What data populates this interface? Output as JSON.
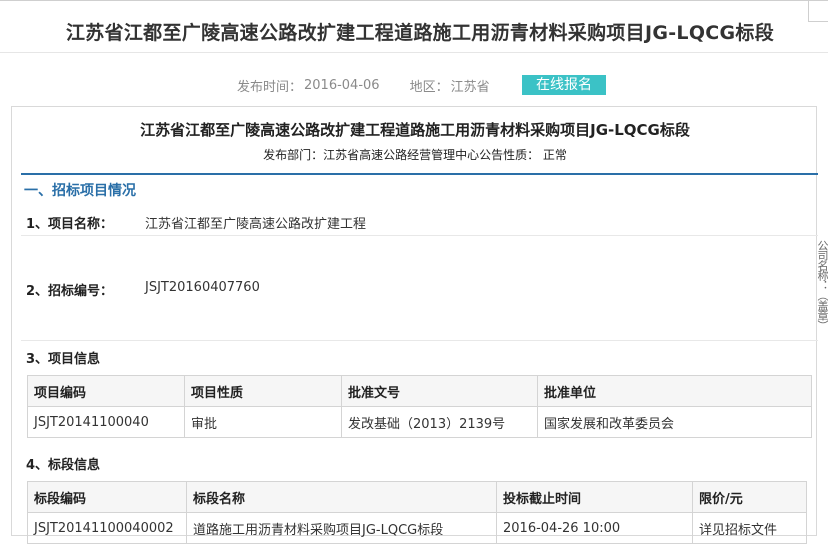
{
  "page": {
    "title": "江苏省江都至广陵高速公路改扩建工程道路施工用沥青材料采购项目JG-LQCG标段",
    "publish_label": "发布时间：",
    "publish_date": "2016-04-06",
    "region_label": "地区：",
    "region": "江苏省",
    "signup_button": "在线报名"
  },
  "doc": {
    "title": "江苏省江都至广陵高速公路改扩建工程道路施工用沥青材料采购项目JG-LQCG标段",
    "subtitle": "发布部门：江苏省高速公路经营管理中心公告性质：  正常",
    "section1": "一、招标项目情况",
    "item1_label": "1、项目名称：",
    "item1_value": "江苏省江都至广陵高速公路改扩建工程",
    "item2_label": "2、招标编号：",
    "item2_value": "JSJT20160407760",
    "item3_label": "3、项目信息",
    "project_table": {
      "headers": [
        "项目编码",
        "项目性质",
        "批准文号",
        "批准单位"
      ],
      "rows": [
        [
          "JSJT20141100040",
          "审批",
          "发改基础（2013）2139号",
          "国家发展和改革委员会"
        ]
      ]
    },
    "item4_label": "4、标段信息",
    "section_table": {
      "headers": [
        "标段编码",
        "标段名称",
        "投标截止时间",
        "限价/元"
      ],
      "rows": [
        [
          "JSJT20141100040002",
          "道路施工用沥青材料采购项目JG-LQCG标段",
          "2016-04-26 10:00",
          "详见招标文件"
        ]
      ]
    },
    "side_text": "公司名称：（盖章）"
  }
}
